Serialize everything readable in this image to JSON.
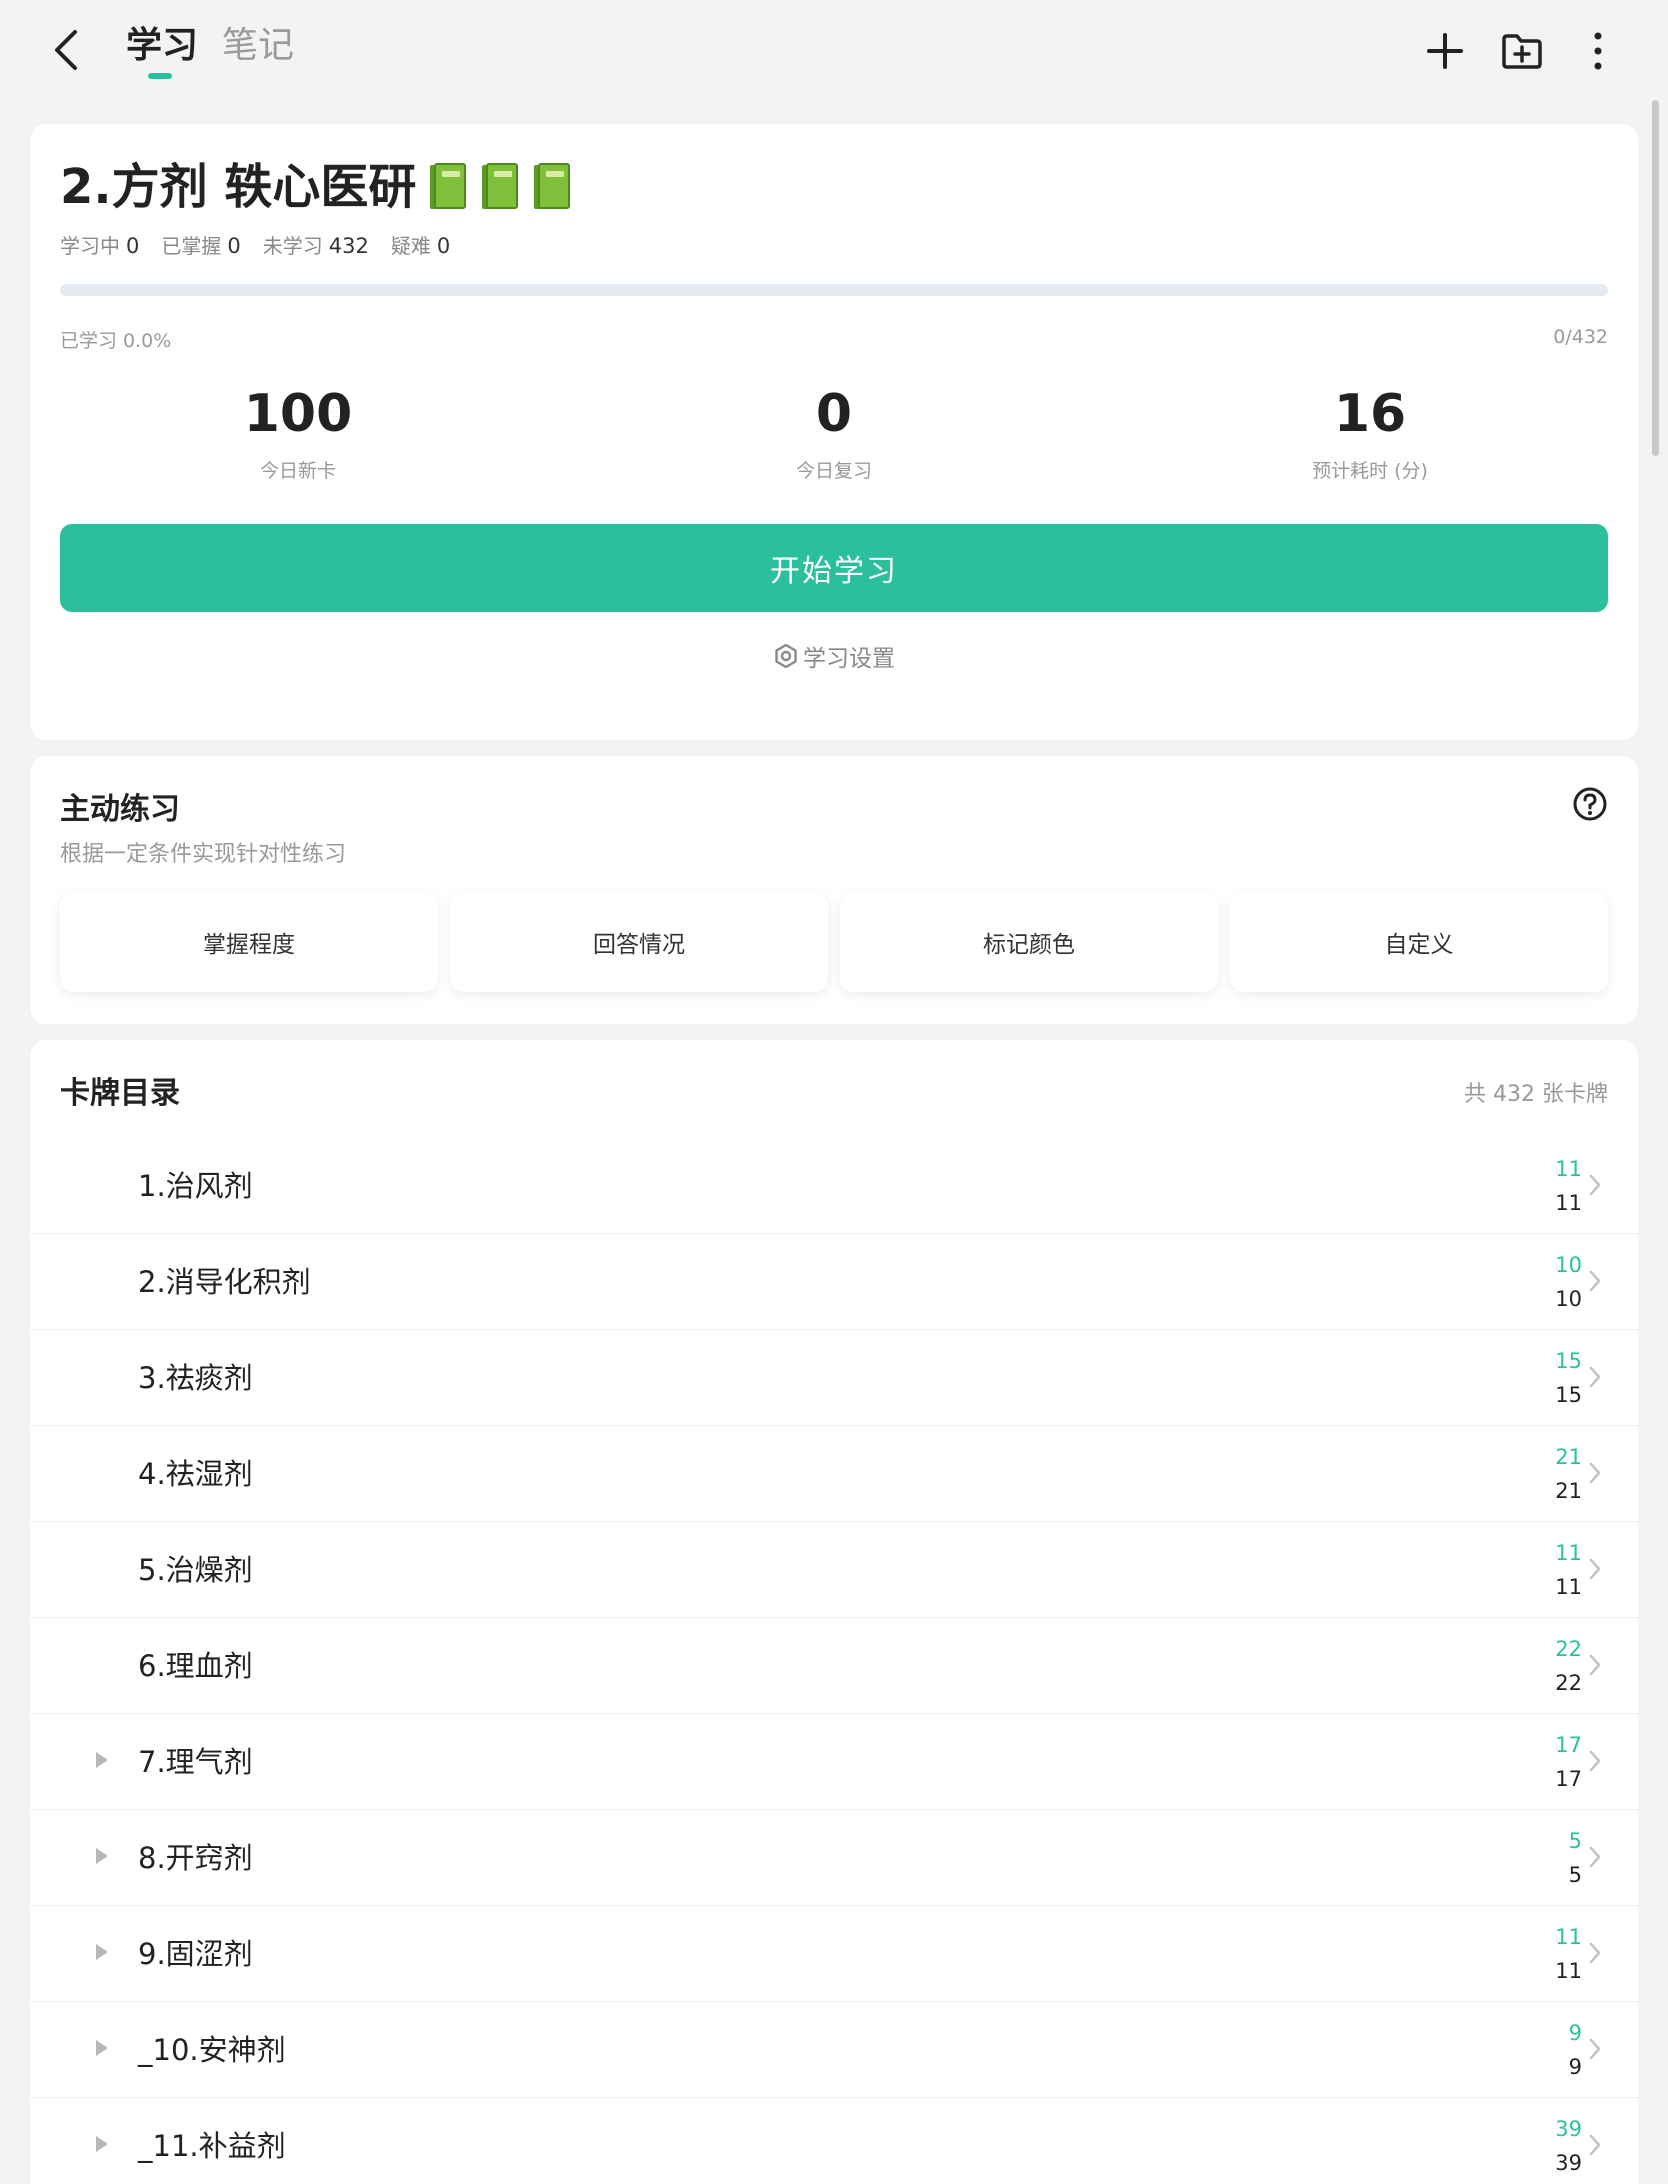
{
  "header": {
    "tabs": [
      {
        "label": "学习"
      },
      {
        "label": "笔记"
      }
    ]
  },
  "deck": {
    "title": "2.方剂 轶心医研",
    "stats": [
      {
        "label": "学习中",
        "value": "0"
      },
      {
        "label": "已掌握",
        "value": "0"
      },
      {
        "label": "未学习",
        "value": "432"
      },
      {
        "label": "疑难",
        "value": "0"
      }
    ],
    "progress_fraction": 0.0,
    "studied_text": "已学习 0.0%",
    "studied_ratio": "0/432",
    "metrics": [
      {
        "value": "100",
        "label": "今日新卡"
      },
      {
        "value": "0",
        "label": "今日复习"
      },
      {
        "value": "16",
        "label": "预计耗时 (分)"
      }
    ],
    "start_label": "开始学习",
    "settings_label": "学习设置"
  },
  "practice": {
    "title": "主动练习",
    "subtitle": "根据一定条件实现针对性练习",
    "buttons": [
      {
        "label": "掌握程度"
      },
      {
        "label": "回答情况"
      },
      {
        "label": "标记颜色"
      },
      {
        "label": "自定义"
      }
    ]
  },
  "catalog": {
    "title": "卡牌目录",
    "count_text": "共 432 张卡牌",
    "items": [
      {
        "name": "1.治风剂",
        "top": "11",
        "bottom": "11",
        "expandable": false
      },
      {
        "name": "2.消导化积剂",
        "top": "10",
        "bottom": "10",
        "expandable": false
      },
      {
        "name": "3.祛痰剂",
        "top": "15",
        "bottom": "15",
        "expandable": false
      },
      {
        "name": "4.祛湿剂",
        "top": "21",
        "bottom": "21",
        "expandable": false
      },
      {
        "name": "5.治燥剂",
        "top": "11",
        "bottom": "11",
        "expandable": false
      },
      {
        "name": "6.理血剂",
        "top": "22",
        "bottom": "22",
        "expandable": false
      },
      {
        "name": "7.理气剂",
        "top": "17",
        "bottom": "17",
        "expandable": true
      },
      {
        "name": "8.开窍剂",
        "top": "5",
        "bottom": "5",
        "expandable": true
      },
      {
        "name": "9.固涩剂",
        "top": "11",
        "bottom": "11",
        "expandable": true
      },
      {
        "name": "_10.安神剂",
        "top": "9",
        "bottom": "9",
        "expandable": true
      },
      {
        "name": "_11.补益剂",
        "top": "39",
        "bottom": "39",
        "expandable": true
      }
    ]
  },
  "colors": {
    "accent": "#2bbf9d",
    "background": "#f2f3f5"
  },
  "icons": [
    "back-icon",
    "plus-icon",
    "folder-add-icon",
    "more-vertical-icon",
    "gear-icon",
    "help-icon",
    "chevron-right-icon",
    "expand-triangle-icon",
    "book-icon"
  ]
}
